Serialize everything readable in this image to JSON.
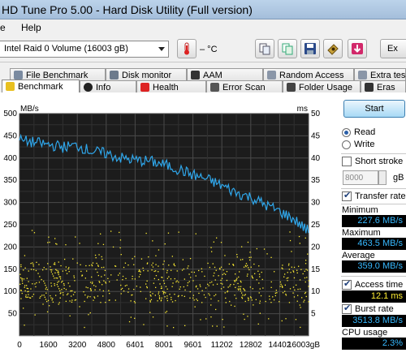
{
  "window": {
    "title": "HD Tune Pro 5.00 - Hard Disk Utility (Full version)"
  },
  "menu": {
    "items": [
      "e",
      "Help"
    ]
  },
  "toolbar": {
    "drive": "Intel  Raid 0 Volume (16003 gB)",
    "temperature": "– °C",
    "exit_label": "Ex",
    "icons": [
      "thermometer-icon",
      "copy-icon",
      "copy-all-icon",
      "save-icon",
      "camera-icon",
      "download-icon"
    ]
  },
  "tabs": {
    "row1": [
      "File Benchmark",
      "Disk monitor",
      "AAM",
      "Random Access",
      "Extra tests"
    ],
    "row2": [
      "Benchmark",
      "Info",
      "Health",
      "Error Scan",
      "Folder Usage",
      "Eras"
    ]
  },
  "side": {
    "start_label": "Start",
    "read_label": "Read",
    "write_label": "Write",
    "short_stroke_label": "Short stroke",
    "short_stroke_value": "8000",
    "short_stroke_unit": "gB",
    "transfer_rate_label": "Transfer rate",
    "minimum_label": "Minimum",
    "minimum_value": "227.6 MB/s",
    "maximum_label": "Maximum",
    "maximum_value": "463.5 MB/s",
    "average_label": "Average",
    "average_value": "359.0 MB/s",
    "access_time_label": "Access time",
    "access_time_value": "12.1 ms",
    "burst_rate_label": "Burst rate",
    "burst_rate_value": "3513.8 MB/s",
    "cpu_usage_label": "CPU usage",
    "cpu_usage_value": "2.3%",
    "read_selected": true,
    "short_stroke_checked": false,
    "transfer_rate_checked": true,
    "access_time_checked": true,
    "burst_rate_checked": true
  },
  "chart_data": {
    "type": "line",
    "left_unit": "MB/s",
    "right_unit": "ms",
    "left_ticks": [
      "500",
      "450",
      "400",
      "350",
      "300",
      "250",
      "200",
      "150",
      "100",
      "50"
    ],
    "right_ticks": [
      "50",
      "45",
      "40",
      "35",
      "30",
      "25",
      "20",
      "15",
      "10",
      "5"
    ],
    "x_ticks": [
      "0",
      "1600",
      "3200",
      "4800",
      "6401",
      "8001",
      "9601",
      "11202",
      "12802",
      "14402",
      "16003gB"
    ],
    "ylim_left": [
      0,
      500
    ],
    "ylim_right": [
      0,
      50
    ],
    "xlim": [
      0,
      16003
    ],
    "grid": true,
    "series": [
      {
        "color": "#2fa6ea",
        "values": [
          [
            0,
            440
          ],
          [
            800,
            435
          ],
          [
            1600,
            430
          ],
          [
            2400,
            425
          ],
          [
            3200,
            428
          ],
          [
            4000,
            415
          ],
          [
            4800,
            410
          ],
          [
            5600,
            400
          ],
          [
            6401,
            395
          ],
          [
            7200,
            393
          ],
          [
            8001,
            385
          ],
          [
            8800,
            375
          ],
          [
            9601,
            362
          ],
          [
            10400,
            352
          ],
          [
            11202,
            338
          ],
          [
            12000,
            322
          ],
          [
            12802,
            312
          ],
          [
            13600,
            295
          ],
          [
            14402,
            280
          ],
          [
            15200,
            262
          ],
          [
            16003,
            235
          ]
        ]
      },
      {
        "color": "#ffee33",
        "axis": "right",
        "scatter_range_ms": [
          2,
          24
        ],
        "typical_ms": 12.1
      }
    ]
  }
}
